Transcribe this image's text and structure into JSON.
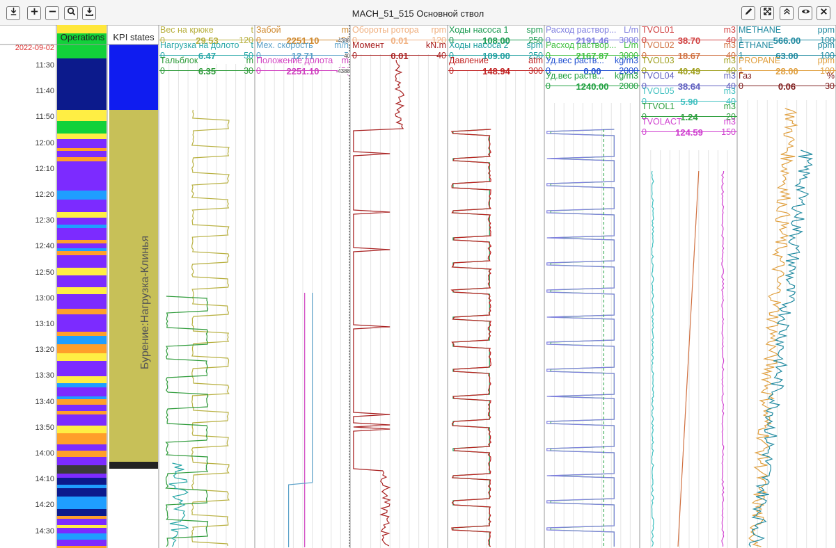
{
  "app": {
    "title": "MACH_51_515 Основной ствол"
  },
  "toolbar": {
    "left_icons": [
      "arrow-down-to-line-icon",
      "plus-icon",
      "minus-icon",
      "search-icon",
      "download-icon"
    ],
    "right_icons": [
      "pencil-icon",
      "expand-icon",
      "chevrons-up-icon",
      "eye-icon",
      "close-icon"
    ]
  },
  "time_axis": {
    "date": "2022-09-02",
    "ticks": [
      "11:30",
      "11:40",
      "11:50",
      "12:00",
      "12:10",
      "12:20",
      "12:30",
      "12:40",
      "12:50",
      "13:00",
      "13:10",
      "13:20",
      "13:30",
      "13:40",
      "13:50",
      "14:00",
      "14:10",
      "14:20",
      "14:30"
    ]
  },
  "columns": {
    "operations": "Operations",
    "kpi": "KPI states",
    "kpi_label": "Бурение:Нагрузка-Клинья"
  },
  "operations_colors": [
    "#ffee44",
    "#1f9eff",
    "#7c2bff",
    "#12d13a",
    "#0c1a8c",
    "#ffe73a",
    "#ff9f2a",
    "#3a3a3a"
  ],
  "kpi_colors": {
    "top": "#0f1cf0",
    "main": "#c7c058",
    "bottom": "#222222"
  },
  "tracks": [
    {
      "curves": [
        {
          "name": "Вес на крюке",
          "unit": "t",
          "min": "0",
          "value": "29.53",
          "max": "120",
          "color": "#b8b040"
        },
        {
          "name": "Нагрузка на долото",
          "unit": "t",
          "min": "0",
          "value": "6.47",
          "max": "50",
          "color": "#2aa8a8"
        },
        {
          "name": "Тальблок",
          "unit": "m",
          "min": "0",
          "value": "6.35",
          "max": "30",
          "color": "#2e9b3a"
        }
      ]
    },
    {
      "curves": [
        {
          "name": "Забой",
          "unit": "m",
          "min": "0",
          "value": "2251.10",
          "max": "45(",
          "color": "#d08a30",
          "badge": "4388"
        },
        {
          "name": "Мех. скорость",
          "unit": "m/h",
          "min": "0",
          "value": "12.71",
          "max": "5",
          "color": "#5aa0c8",
          "badge": "40"
        },
        {
          "name": "Положение долота",
          "unit": "m",
          "min": "0",
          "value": "2251.10",
          "max": "45(",
          "color": "#d040c0",
          "badge": "4388"
        }
      ]
    },
    {
      "curves": [
        {
          "name": "Обороты ротора",
          "unit": "rpm",
          "min": "0",
          "value": "0.01",
          "max": "120",
          "color": "#f0b080"
        },
        {
          "name": "Момент",
          "unit": "kN.m",
          "min": "0",
          "value": "0.01",
          "max": "40",
          "color": "#a82020"
        }
      ]
    },
    {
      "curves": [
        {
          "name": "Ходы насоса 1",
          "unit": "spm",
          "min": "0",
          "value": "108.00",
          "max": "250",
          "color": "#1a9a50"
        },
        {
          "name": "Ходы насоса 2",
          "unit": "spm",
          "min": "0",
          "value": "109.00",
          "max": "250",
          "color": "#20a0a0"
        },
        {
          "name": "Давление",
          "unit": "atm",
          "min": "0",
          "value": "148.94",
          "max": "300",
          "color": "#c02020"
        }
      ]
    },
    {
      "curves": [
        {
          "name": "Расход раствор...",
          "unit": "L/m",
          "min": "0",
          "value": "2191.46",
          "max": "3000",
          "color": "#8080e0"
        },
        {
          "name": "Расход раствор...",
          "unit": "L/m",
          "min": "0",
          "value": "2167.87",
          "max": "3000",
          "color": "#40c040"
        },
        {
          "name": "Уд.вес раств...",
          "unit": "kg/m3",
          "min": "0",
          "value": "0.00",
          "max": "2000",
          "color": "#2050d0"
        },
        {
          "name": "Уд.вес раств...",
          "unit": "kg/m3",
          "min": "0",
          "value": "1240.00",
          "max": "2000",
          "color": "#20a040"
        }
      ]
    },
    {
      "curves": [
        {
          "name": "TVOL01",
          "unit": "m3",
          "min": "0",
          "value": "38.70",
          "max": "40",
          "color": "#d04040"
        },
        {
          "name": "TVOL02",
          "unit": "m3",
          "min": "0",
          "value": "18.67",
          "max": "40",
          "color": "#d07040"
        },
        {
          "name": "TVOL03",
          "unit": "m3",
          "min": "0",
          "value": "40.49",
          "max": "40",
          "color": "#a0a020"
        },
        {
          "name": "TVOL04",
          "unit": "m3",
          "min": "0",
          "value": "38.64",
          "max": "40",
          "color": "#6060c0"
        },
        {
          "name": "TVOL05",
          "unit": "m3",
          "min": "0",
          "value": "5.90",
          "max": "40",
          "color": "#40c0c0"
        },
        {
          "name": "TTVOL1",
          "unit": "m3",
          "min": "0",
          "value": "1.24",
          "max": "20",
          "color": "#30a040"
        },
        {
          "name": "TVOLACT",
          "unit": "m3",
          "min": "0",
          "value": "124.59",
          "max": "150",
          "color": "#d040d0"
        }
      ]
    },
    {
      "curves": [
        {
          "name": "METHANE",
          "unit": "ppm",
          "min": "1",
          "value": "566.00",
          "max": "100",
          "color": "#208aa0"
        },
        {
          "name": "ETHANE",
          "unit": "ppm",
          "min": "1",
          "value": "63.00",
          "max": "100",
          "color": "#208aa0"
        },
        {
          "name": "PROPANE",
          "unit": "ppm",
          "min": "1",
          "value": "28.00",
          "max": "100",
          "color": "#e0a040"
        },
        {
          "name": "Газ",
          "unit": "%",
          "min": "0",
          "value": "0.06",
          "max": "30",
          "color": "#802020"
        }
      ]
    }
  ]
}
